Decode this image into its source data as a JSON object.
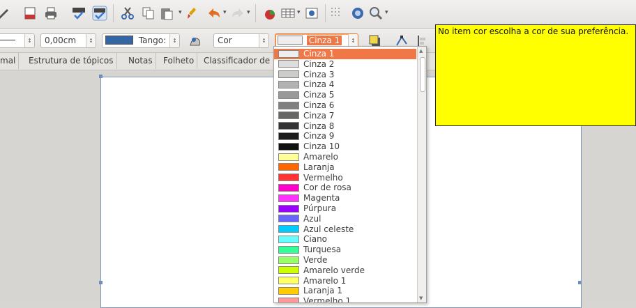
{
  "toolbar2": {
    "spin_blank_arrow": "↕",
    "line_width": "0,00cm",
    "line_color_name": "Tango:",
    "fill_style": "Cor",
    "fill_color_value": "Cinza 1",
    "line_color_hex": "#3465a4"
  },
  "tabs": [
    "mal",
    "Estrutura de tópicos",
    "Notas",
    "Folheto",
    "Classificador de"
  ],
  "color_list": {
    "selected": "Cinza 1",
    "items": [
      {
        "name": "Cinza 1",
        "color": "#eeeeee"
      },
      {
        "name": "Cinza 2",
        "color": "#dddddd"
      },
      {
        "name": "Cinza 3",
        "color": "#cccccc"
      },
      {
        "name": "Cinza 4",
        "color": "#b2b2b2"
      },
      {
        "name": "Cinza 5",
        "color": "#999999"
      },
      {
        "name": "Cinza 6",
        "color": "#808080"
      },
      {
        "name": "Cinza 7",
        "color": "#666666"
      },
      {
        "name": "Cinza 8",
        "color": "#333333"
      },
      {
        "name": "Cinza 9",
        "color": "#1c1c1c"
      },
      {
        "name": "Cinza 10",
        "color": "#111111"
      },
      {
        "name": "Amarelo",
        "color": "#ffff99"
      },
      {
        "name": "Laranja",
        "color": "#ff6600"
      },
      {
        "name": "Vermelho",
        "color": "#ff3333"
      },
      {
        "name": "Cor de rosa",
        "color": "#ff00cc"
      },
      {
        "name": "Magenta",
        "color": "#ff33ff"
      },
      {
        "name": "Púrpura",
        "color": "#9900ff"
      },
      {
        "name": "Azul",
        "color": "#6666ff"
      },
      {
        "name": "Azul celeste",
        "color": "#00ccff"
      },
      {
        "name": "Ciano",
        "color": "#66ffff"
      },
      {
        "name": "Turquesa",
        "color": "#33ff99"
      },
      {
        "name": "Verde",
        "color": "#99ff66"
      },
      {
        "name": "Amarelo verde",
        "color": "#ccff00"
      },
      {
        "name": "Amarelo 1",
        "color": "#ffff66"
      },
      {
        "name": "Laranja 1",
        "color": "#ffcc00"
      },
      {
        "name": "Vermelho 1",
        "color": "#ff9999"
      }
    ]
  },
  "note": {
    "text": "No item cor escolha a cor de sua preferência."
  },
  "colors": {
    "note_bg": "#ffff00",
    "selection": "#f07746",
    "focus_border": "#e9742f"
  }
}
